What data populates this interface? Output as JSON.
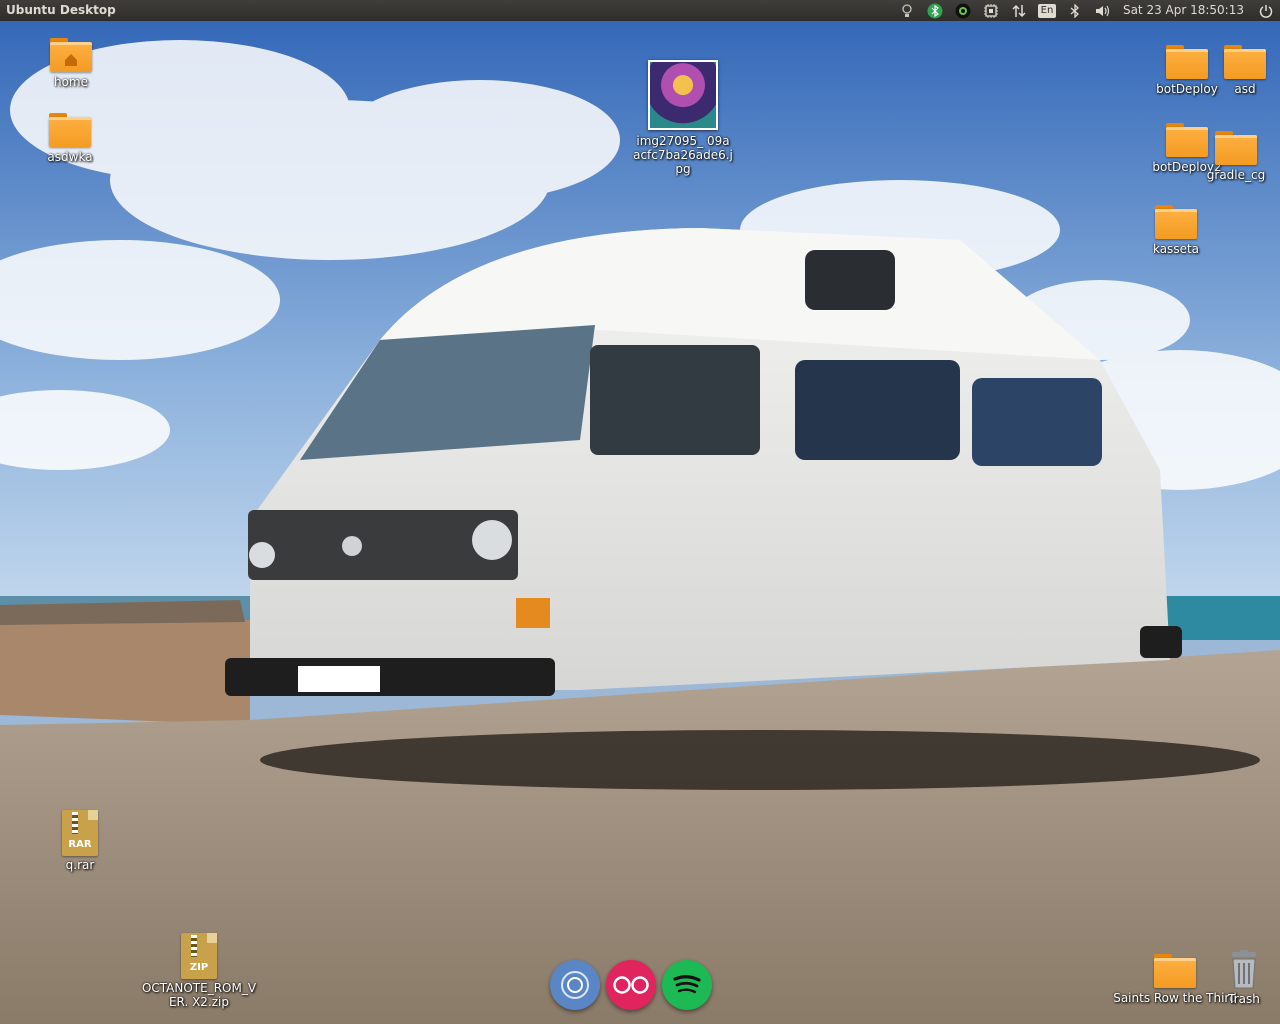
{
  "panel": {
    "title": "Ubuntu Desktop",
    "language": "En",
    "clock": "Sat 23 Apr 18:50:13"
  },
  "tray_icons": [
    "lightbulb-icon",
    "bluetooth-status-icon",
    "chat-status-icon",
    "cpu-monitor-icon",
    "network-transfer-icon",
    "keyboard-language-icon",
    "bluetooth-icon",
    "volume-icon",
    "session-power-icon"
  ],
  "desktop": {
    "icons": [
      {
        "label": "home",
        "type": "folder-home"
      },
      {
        "label": "asdwka",
        "type": "folder"
      },
      {
        "label": "img27095_ 09aacfc7ba26ade6.jpg",
        "type": "image"
      },
      {
        "label": "botDeploy",
        "type": "folder"
      },
      {
        "label": "asd",
        "type": "folder"
      },
      {
        "label": "botDeploy2",
        "type": "folder"
      },
      {
        "label": "gradle_cg",
        "type": "folder"
      },
      {
        "label": "kasseta",
        "type": "folder"
      },
      {
        "label": "q.rar",
        "type": "archive",
        "tag": "RAR"
      },
      {
        "label": "OCTANOTE_ROM_VER. X2.zip",
        "type": "archive",
        "tag": "ZIP"
      },
      {
        "label": "Saints Row the Third",
        "type": "folder"
      },
      {
        "label": "Trash",
        "type": "trash"
      }
    ]
  },
  "dock": {
    "apps": [
      "chromium-icon",
      "flickr-icon",
      "spotify-icon"
    ]
  },
  "colors": {
    "panel_bg": "#2e2d2a",
    "folder_orange": "#f49b22",
    "sky_blue": "#3f76c4"
  }
}
